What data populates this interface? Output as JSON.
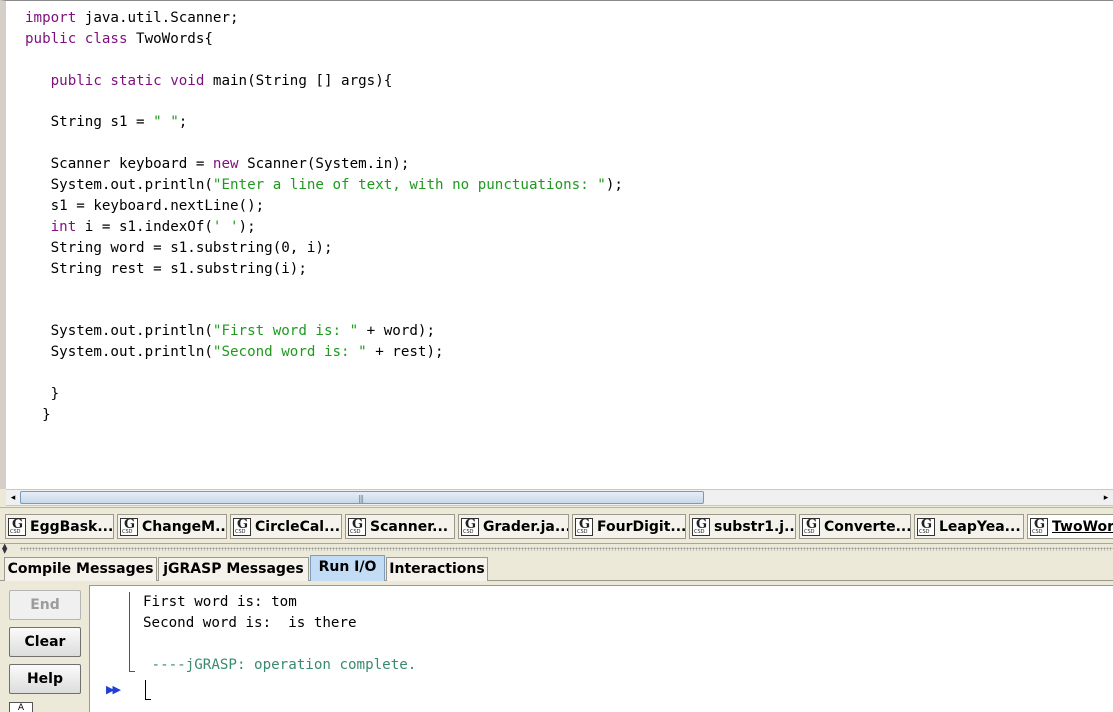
{
  "editor": {
    "lines": [
      {
        "segments": [
          {
            "t": "kw",
            "v": "import"
          },
          {
            "t": "plain",
            "v": " java.util.Scanner;"
          }
        ]
      },
      {
        "segments": [
          {
            "t": "kw",
            "v": "public class"
          },
          {
            "t": "plain",
            "v": " TwoWords{"
          }
        ]
      },
      {
        "segments": [
          {
            "t": "plain",
            "v": ""
          }
        ]
      },
      {
        "segments": [
          {
            "t": "plain",
            "v": "   "
          },
          {
            "t": "kw",
            "v": "public static void"
          },
          {
            "t": "plain",
            "v": " main(String [] args){"
          }
        ]
      },
      {
        "segments": [
          {
            "t": "plain",
            "v": ""
          }
        ]
      },
      {
        "segments": [
          {
            "t": "plain",
            "v": "   String s1 = "
          },
          {
            "t": "str",
            "v": "\" \""
          },
          {
            "t": "plain",
            "v": ";"
          }
        ]
      },
      {
        "segments": [
          {
            "t": "plain",
            "v": ""
          }
        ]
      },
      {
        "segments": [
          {
            "t": "plain",
            "v": "   Scanner keyboard = "
          },
          {
            "t": "kw",
            "v": "new"
          },
          {
            "t": "plain",
            "v": " Scanner(System.in);"
          }
        ]
      },
      {
        "segments": [
          {
            "t": "plain",
            "v": "   System.out.println("
          },
          {
            "t": "str",
            "v": "\"Enter a line of text, with no punctuations: \""
          },
          {
            "t": "plain",
            "v": ");"
          }
        ]
      },
      {
        "segments": [
          {
            "t": "plain",
            "v": "   s1 = keyboard.nextLine();"
          }
        ]
      },
      {
        "segments": [
          {
            "t": "plain",
            "v": "   "
          },
          {
            "t": "kw",
            "v": "int"
          },
          {
            "t": "plain",
            "v": " i = s1.indexOf("
          },
          {
            "t": "str",
            "v": "' '"
          },
          {
            "t": "plain",
            "v": ");"
          }
        ]
      },
      {
        "segments": [
          {
            "t": "plain",
            "v": "   String word = s1.substring(0, i);"
          }
        ]
      },
      {
        "segments": [
          {
            "t": "plain",
            "v": "   String rest = s1.substring(i);"
          }
        ]
      },
      {
        "segments": [
          {
            "t": "plain",
            "v": ""
          }
        ]
      },
      {
        "segments": [
          {
            "t": "plain",
            "v": ""
          }
        ]
      },
      {
        "segments": [
          {
            "t": "plain",
            "v": "   System.out.println("
          },
          {
            "t": "str",
            "v": "\"First word is: \""
          },
          {
            "t": "plain",
            "v": " + word);"
          }
        ]
      },
      {
        "segments": [
          {
            "t": "plain",
            "v": "   System.out.println("
          },
          {
            "t": "str",
            "v": "\"Second word is: \""
          },
          {
            "t": "plain",
            "v": " + rest);"
          }
        ]
      },
      {
        "segments": [
          {
            "t": "plain",
            "v": ""
          }
        ]
      },
      {
        "segments": [
          {
            "t": "plain",
            "v": "   }"
          }
        ]
      },
      {
        "segments": [
          {
            "t": "plain",
            "v": "  }"
          }
        ]
      }
    ],
    "colors": {
      "keyword": "#7f0f7f",
      "string": "#1f9a1f",
      "background": "#ffffff"
    }
  },
  "scrollbar": {
    "left_arrow": "◂",
    "right_arrow": "▸",
    "grip": "|||"
  },
  "file_tabs": [
    {
      "label": "EggBask...",
      "icon": "jgrasp-csd-icon"
    },
    {
      "label": "ChangeM...",
      "icon": "jgrasp-csd-icon"
    },
    {
      "label": "CircleCal...",
      "icon": "jgrasp-csd-icon"
    },
    {
      "label": "Scanner...",
      "icon": "jgrasp-csd-icon"
    },
    {
      "label": "Grader.ja...",
      "icon": "jgrasp-csd-icon"
    },
    {
      "label": "FourDigit...",
      "icon": "jgrasp-csd-icon"
    },
    {
      "label": "substr1.j...",
      "icon": "jgrasp-csd-icon"
    },
    {
      "label": "Converte...",
      "icon": "jgrasp-csd-icon"
    },
    {
      "label": "LeapYea...",
      "icon": "jgrasp-csd-icon"
    },
    {
      "label": "TwoWords",
      "icon": "jgrasp-csd-icon",
      "active": true
    }
  ],
  "file_tab_icon": {
    "glyph": "G",
    "sub": "CSD"
  },
  "splitter": {
    "arrows": "▲\n▼"
  },
  "message_tabs": [
    {
      "label": "Compile Messages"
    },
    {
      "label": "jGRASP Messages"
    },
    {
      "label": "Run I/O",
      "active": true
    },
    {
      "label": "Interactions"
    }
  ],
  "side_buttons": {
    "end": "End",
    "clear": "Clear",
    "help": "Help",
    "mini": "A"
  },
  "console": {
    "lines": [
      "First word is: tom",
      "Second word is:  is there",
      "",
      " ----jGRASP: operation complete."
    ],
    "prompt": "▶▶",
    "status_color": "#3a8a6e"
  }
}
